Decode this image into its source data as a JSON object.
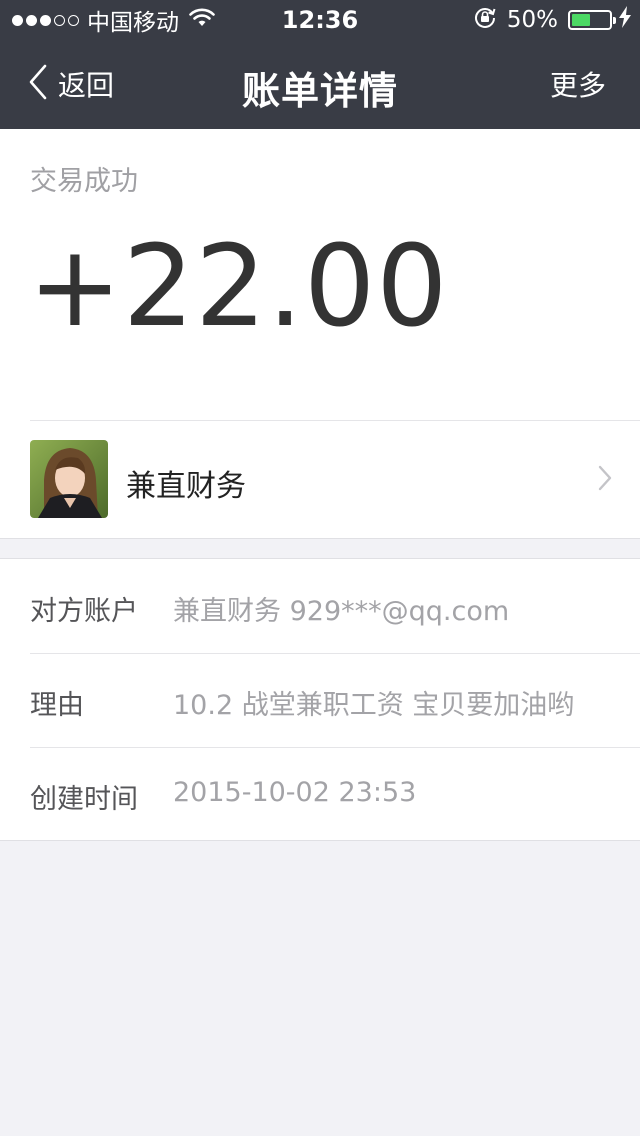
{
  "status_bar": {
    "carrier": "中国移动",
    "time": "12:36",
    "battery_percent": "50%",
    "battery_level": 0.5,
    "signal_bars_filled": 3,
    "signal_bars_total": 5
  },
  "nav": {
    "back_label": "返回",
    "title": "账单详情",
    "more_label": "更多"
  },
  "transaction": {
    "status": "交易成功",
    "amount": "+22.00",
    "payer_name": "兼直财务"
  },
  "details": [
    {
      "label": "对方账户",
      "value": "兼直财务 929***@qq.com"
    },
    {
      "label": "理由",
      "value": "10.2 战堂兼职工资 宝贝要加油哟"
    },
    {
      "label": "创建时间",
      "value": "2015-10-02 23:53"
    }
  ],
  "colors": {
    "header_bg": "#393c45",
    "page_bg": "#f2f2f6",
    "battery_green": "#4cd964"
  },
  "icons": {
    "wifi": "wifi-icon",
    "rotation_lock": "rotation-lock-icon",
    "charging": "charging-bolt-icon",
    "back": "chevron-left-icon",
    "disclosure": "chevron-right-icon"
  }
}
